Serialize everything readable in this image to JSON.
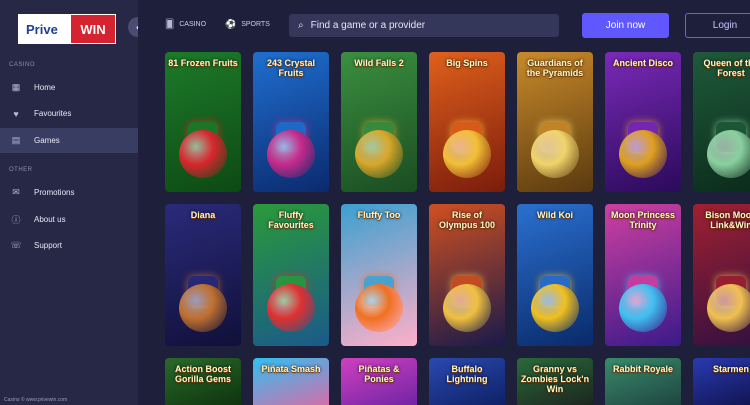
{
  "brand": {
    "logo_left": "Prive",
    "logo_right": "WIN"
  },
  "sidebar": {
    "section_casino": "CASINO",
    "section_other": "OTHER",
    "items": [
      {
        "label": "Home",
        "icon": "grid-icon",
        "glyph": "▦"
      },
      {
        "label": "Favourites",
        "icon": "heart-icon",
        "glyph": "♥"
      },
      {
        "label": "Games",
        "icon": "games-icon",
        "glyph": "▤"
      },
      {
        "label": "Promotions",
        "icon": "megaphone-icon",
        "glyph": "✉"
      },
      {
        "label": "About us",
        "icon": "info-icon",
        "glyph": "ⓘ"
      },
      {
        "label": "Support",
        "icon": "support-icon",
        "glyph": "☏"
      }
    ],
    "footer_url": "Casino © www.privewin.com"
  },
  "header": {
    "tabs": [
      {
        "label": "CASINO",
        "icon": "casino-icon",
        "glyph": "🂠"
      },
      {
        "label": "SPORTS",
        "icon": "soccer-ball-icon",
        "glyph": "⚽"
      }
    ],
    "search_placeholder": "Find a game or a provider",
    "join_label": "Join now",
    "login_label": "Login"
  },
  "games": [
    {
      "title": "81 Frozen Fruits",
      "bg": "#1d7a2a",
      "bg2": "#0d4a14",
      "accent": "#d9262e"
    },
    {
      "title": "243 Crystal Fruits",
      "bg": "#1f6fd0",
      "bg2": "#0b2a6e",
      "accent": "#c62a8a"
    },
    {
      "title": "Wild Falls 2",
      "bg": "#3a8f3f",
      "bg2": "#1b4d22",
      "accent": "#d9a72a"
    },
    {
      "title": "Big Spins",
      "bg": "#e0601c",
      "bg2": "#7a1c0c",
      "accent": "#f2c036"
    },
    {
      "title": "Guardians of the Pyramids",
      "bg": "#c98a2a",
      "bg2": "#5a3a10",
      "accent": "#f0d46a"
    },
    {
      "title": "Ancient Disco",
      "bg": "#7a2ab8",
      "bg2": "#2a0a5a",
      "accent": "#e0a020"
    },
    {
      "title": "Queen of the Forest",
      "bg": "#1f5a3a",
      "bg2": "#0b2a1a",
      "accent": "#8ad0a0"
    },
    {
      "title": "Diana",
      "bg": "#2a2a7a",
      "bg2": "#10103a",
      "accent": "#c07030"
    },
    {
      "title": "Fluffy Favourites",
      "bg": "#2a9a3a",
      "bg2": "#1a5a8a",
      "accent": "#e03030"
    },
    {
      "title": "Fluffy Too",
      "bg": "#3aa0d0",
      "bg2": "#ffb0c8",
      "accent": "#f07020"
    },
    {
      "title": "Rise of Olympus 100",
      "bg": "#d05020",
      "bg2": "#1a1a4a",
      "accent": "#f0c040"
    },
    {
      "title": "Wild Koi",
      "bg": "#2a70d0",
      "bg2": "#0a2a6a",
      "accent": "#f0c020"
    },
    {
      "title": "Moon Princess Trinity",
      "bg": "#d040a0",
      "bg2": "#3a1a8a",
      "accent": "#40c0f0"
    },
    {
      "title": "Bison Moon Link&Win",
      "bg": "#a02030",
      "bg2": "#301040",
      "accent": "#f0c050"
    },
    {
      "title": "Action Boost Gorilla Gems",
      "bg": "#2a6a2a",
      "bg2": "#0a2a0a",
      "accent": "#f0c020"
    },
    {
      "title": "Piñata Smash",
      "bg": "#30c0f0",
      "bg2": "#f060a0",
      "accent": "#f0e040"
    },
    {
      "title": "Piñatas & Ponies",
      "bg": "#d040c0",
      "bg2": "#6020a0",
      "accent": "#f0e040"
    },
    {
      "title": "Buffalo Lightning",
      "bg": "#2a4ab0",
      "bg2": "#0a1a5a",
      "accent": "#f0d040"
    },
    {
      "title": "Granny vs Zombies Lock'n Win",
      "bg": "#2a6a3a",
      "bg2": "#1a1a1a",
      "accent": "#f0e050"
    },
    {
      "title": "Rabbit Royale",
      "bg": "#3a8a6a",
      "bg2": "#1a3a3a",
      "accent": "#e0c040"
    },
    {
      "title": "Starmen",
      "bg": "#2a3ab0",
      "bg2": "#0a0a3a",
      "accent": "#f0f0ff"
    }
  ]
}
